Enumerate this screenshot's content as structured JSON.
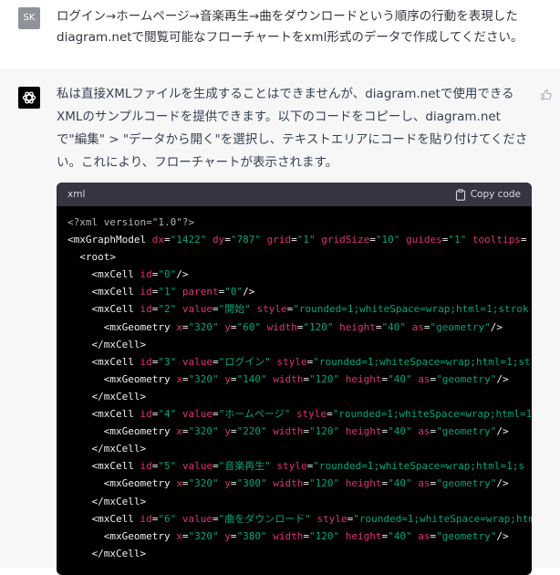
{
  "user": {
    "avatar_initials": "SK",
    "message": "ログイン→ホームページ→音楽再生→曲をダウンロードという順序の行動を表現したdiagram.netで閲覧可能なフローチャートをxml形式のデータで作成してください。"
  },
  "assistant": {
    "message": "私は直接XMLファイルを生成することはできませんが、diagram.netで使用できるXMLのサンプルコードを提供できます。以下のコードをコピーし、diagram.netで\"編集\" > \"データから開く\"を選択し、テキストエリアにコードを貼り付けてください。これにより、フローチャートが表示されます。",
    "code": {
      "language": "xml",
      "copy_label": "Copy code",
      "lines": [
        [
          {
            "t": "d",
            "s": "<?xml version=\"1.0\"?>"
          }
        ],
        [
          {
            "t": "t",
            "s": "<mxGraphModel "
          },
          {
            "t": "a",
            "s": "dx"
          },
          {
            "t": "t",
            "s": "="
          },
          {
            "t": "v",
            "s": "\"1422\""
          },
          {
            "t": "t",
            "s": " "
          },
          {
            "t": "a",
            "s": "dy"
          },
          {
            "t": "t",
            "s": "="
          },
          {
            "t": "v",
            "s": "\"787\""
          },
          {
            "t": "t",
            "s": " "
          },
          {
            "t": "a",
            "s": "grid"
          },
          {
            "t": "t",
            "s": "="
          },
          {
            "t": "v",
            "s": "\"1\""
          },
          {
            "t": "t",
            "s": " "
          },
          {
            "t": "a",
            "s": "gridSize"
          },
          {
            "t": "t",
            "s": "="
          },
          {
            "t": "v",
            "s": "\"10\""
          },
          {
            "t": "t",
            "s": " "
          },
          {
            "t": "a",
            "s": "guides"
          },
          {
            "t": "t",
            "s": "="
          },
          {
            "t": "v",
            "s": "\"1\""
          },
          {
            "t": "t",
            "s": " "
          },
          {
            "t": "a",
            "s": "tooltips"
          },
          {
            "t": "t",
            "s": "="
          }
        ],
        [
          {
            "t": "t",
            "s": "  <root>"
          }
        ],
        [
          {
            "t": "t",
            "s": "    <mxCell "
          },
          {
            "t": "a",
            "s": "id"
          },
          {
            "t": "t",
            "s": "="
          },
          {
            "t": "v",
            "s": "\"0\""
          },
          {
            "t": "t",
            "s": "/>"
          }
        ],
        [
          {
            "t": "t",
            "s": "    <mxCell "
          },
          {
            "t": "a",
            "s": "id"
          },
          {
            "t": "t",
            "s": "="
          },
          {
            "t": "v",
            "s": "\"1\""
          },
          {
            "t": "t",
            "s": " "
          },
          {
            "t": "a",
            "s": "parent"
          },
          {
            "t": "t",
            "s": "="
          },
          {
            "t": "v",
            "s": "\"0\""
          },
          {
            "t": "t",
            "s": "/>"
          }
        ],
        [
          {
            "t": "t",
            "s": "    <mxCell "
          },
          {
            "t": "a",
            "s": "id"
          },
          {
            "t": "t",
            "s": "="
          },
          {
            "t": "v",
            "s": "\"2\""
          },
          {
            "t": "t",
            "s": " "
          },
          {
            "t": "a",
            "s": "value"
          },
          {
            "t": "t",
            "s": "="
          },
          {
            "t": "v",
            "s": "\"開始\""
          },
          {
            "t": "t",
            "s": " "
          },
          {
            "t": "a",
            "s": "style"
          },
          {
            "t": "t",
            "s": "="
          },
          {
            "t": "v",
            "s": "\"rounded=1;whiteSpace=wrap;html=1;strok"
          }
        ],
        [
          {
            "t": "t",
            "s": "      <mxGeometry "
          },
          {
            "t": "a",
            "s": "x"
          },
          {
            "t": "t",
            "s": "="
          },
          {
            "t": "v",
            "s": "\"320\""
          },
          {
            "t": "t",
            "s": " "
          },
          {
            "t": "a",
            "s": "y"
          },
          {
            "t": "t",
            "s": "="
          },
          {
            "t": "v",
            "s": "\"60\""
          },
          {
            "t": "t",
            "s": " "
          },
          {
            "t": "a",
            "s": "width"
          },
          {
            "t": "t",
            "s": "="
          },
          {
            "t": "v",
            "s": "\"120\""
          },
          {
            "t": "t",
            "s": " "
          },
          {
            "t": "a",
            "s": "height"
          },
          {
            "t": "t",
            "s": "="
          },
          {
            "t": "v",
            "s": "\"40\""
          },
          {
            "t": "t",
            "s": " "
          },
          {
            "t": "a",
            "s": "as"
          },
          {
            "t": "t",
            "s": "="
          },
          {
            "t": "v",
            "s": "\"geometry\""
          },
          {
            "t": "t",
            "s": "/>"
          }
        ],
        [
          {
            "t": "t",
            "s": "    </mxCell>"
          }
        ],
        [
          {
            "t": "t",
            "s": "    <mxCell "
          },
          {
            "t": "a",
            "s": "id"
          },
          {
            "t": "t",
            "s": "="
          },
          {
            "t": "v",
            "s": "\"3\""
          },
          {
            "t": "t",
            "s": " "
          },
          {
            "t": "a",
            "s": "value"
          },
          {
            "t": "t",
            "s": "="
          },
          {
            "t": "v",
            "s": "\"ログイン\""
          },
          {
            "t": "t",
            "s": " "
          },
          {
            "t": "a",
            "s": "style"
          },
          {
            "t": "t",
            "s": "="
          },
          {
            "t": "v",
            "s": "\"rounded=1;whiteSpace=wrap;html=1;st"
          }
        ],
        [
          {
            "t": "t",
            "s": "      <mxGeometry "
          },
          {
            "t": "a",
            "s": "x"
          },
          {
            "t": "t",
            "s": "="
          },
          {
            "t": "v",
            "s": "\"320\""
          },
          {
            "t": "t",
            "s": " "
          },
          {
            "t": "a",
            "s": "y"
          },
          {
            "t": "t",
            "s": "="
          },
          {
            "t": "v",
            "s": "\"140\""
          },
          {
            "t": "t",
            "s": " "
          },
          {
            "t": "a",
            "s": "width"
          },
          {
            "t": "t",
            "s": "="
          },
          {
            "t": "v",
            "s": "\"120\""
          },
          {
            "t": "t",
            "s": " "
          },
          {
            "t": "a",
            "s": "height"
          },
          {
            "t": "t",
            "s": "="
          },
          {
            "t": "v",
            "s": "\"40\""
          },
          {
            "t": "t",
            "s": " "
          },
          {
            "t": "a",
            "s": "as"
          },
          {
            "t": "t",
            "s": "="
          },
          {
            "t": "v",
            "s": "\"geometry\""
          },
          {
            "t": "t",
            "s": "/>"
          }
        ],
        [
          {
            "t": "t",
            "s": "    </mxCell>"
          }
        ],
        [
          {
            "t": "t",
            "s": "    <mxCell "
          },
          {
            "t": "a",
            "s": "id"
          },
          {
            "t": "t",
            "s": "="
          },
          {
            "t": "v",
            "s": "\"4\""
          },
          {
            "t": "t",
            "s": " "
          },
          {
            "t": "a",
            "s": "value"
          },
          {
            "t": "t",
            "s": "="
          },
          {
            "t": "v",
            "s": "\"ホームページ\""
          },
          {
            "t": "t",
            "s": " "
          },
          {
            "t": "a",
            "s": "style"
          },
          {
            "t": "t",
            "s": "="
          },
          {
            "t": "v",
            "s": "\"rounded=1;whiteSpace=wrap;html=1"
          }
        ],
        [
          {
            "t": "t",
            "s": "      <mxGeometry "
          },
          {
            "t": "a",
            "s": "x"
          },
          {
            "t": "t",
            "s": "="
          },
          {
            "t": "v",
            "s": "\"320\""
          },
          {
            "t": "t",
            "s": " "
          },
          {
            "t": "a",
            "s": "y"
          },
          {
            "t": "t",
            "s": "="
          },
          {
            "t": "v",
            "s": "\"220\""
          },
          {
            "t": "t",
            "s": " "
          },
          {
            "t": "a",
            "s": "width"
          },
          {
            "t": "t",
            "s": "="
          },
          {
            "t": "v",
            "s": "\"120\""
          },
          {
            "t": "t",
            "s": " "
          },
          {
            "t": "a",
            "s": "height"
          },
          {
            "t": "t",
            "s": "="
          },
          {
            "t": "v",
            "s": "\"40\""
          },
          {
            "t": "t",
            "s": " "
          },
          {
            "t": "a",
            "s": "as"
          },
          {
            "t": "t",
            "s": "="
          },
          {
            "t": "v",
            "s": "\"geometry\""
          },
          {
            "t": "t",
            "s": "/>"
          }
        ],
        [
          {
            "t": "t",
            "s": "    </mxCell>"
          }
        ],
        [
          {
            "t": "t",
            "s": "    <mxCell "
          },
          {
            "t": "a",
            "s": "id"
          },
          {
            "t": "t",
            "s": "="
          },
          {
            "t": "v",
            "s": "\"5\""
          },
          {
            "t": "t",
            "s": " "
          },
          {
            "t": "a",
            "s": "value"
          },
          {
            "t": "t",
            "s": "="
          },
          {
            "t": "v",
            "s": "\"音楽再生\""
          },
          {
            "t": "t",
            "s": " "
          },
          {
            "t": "a",
            "s": "style"
          },
          {
            "t": "t",
            "s": "="
          },
          {
            "t": "v",
            "s": "\"rounded=1;whiteSpace=wrap;html=1;s"
          }
        ],
        [
          {
            "t": "t",
            "s": "      <mxGeometry "
          },
          {
            "t": "a",
            "s": "x"
          },
          {
            "t": "t",
            "s": "="
          },
          {
            "t": "v",
            "s": "\"320\""
          },
          {
            "t": "t",
            "s": " "
          },
          {
            "t": "a",
            "s": "y"
          },
          {
            "t": "t",
            "s": "="
          },
          {
            "t": "v",
            "s": "\"300\""
          },
          {
            "t": "t",
            "s": " "
          },
          {
            "t": "a",
            "s": "width"
          },
          {
            "t": "t",
            "s": "="
          },
          {
            "t": "v",
            "s": "\"120\""
          },
          {
            "t": "t",
            "s": " "
          },
          {
            "t": "a",
            "s": "height"
          },
          {
            "t": "t",
            "s": "="
          },
          {
            "t": "v",
            "s": "\"40\""
          },
          {
            "t": "t",
            "s": " "
          },
          {
            "t": "a",
            "s": "as"
          },
          {
            "t": "t",
            "s": "="
          },
          {
            "t": "v",
            "s": "\"geometry\""
          },
          {
            "t": "t",
            "s": "/>"
          }
        ],
        [
          {
            "t": "t",
            "s": "    </mxCell>"
          }
        ],
        [
          {
            "t": "t",
            "s": "    <mxCell "
          },
          {
            "t": "a",
            "s": "id"
          },
          {
            "t": "t",
            "s": "="
          },
          {
            "t": "v",
            "s": "\"6\""
          },
          {
            "t": "t",
            "s": " "
          },
          {
            "t": "a",
            "s": "value"
          },
          {
            "t": "t",
            "s": "="
          },
          {
            "t": "v",
            "s": "\"曲をダウンロード\""
          },
          {
            "t": "t",
            "s": " "
          },
          {
            "t": "a",
            "s": "style"
          },
          {
            "t": "t",
            "s": "="
          },
          {
            "t": "v",
            "s": "\"rounded=1;whiteSpace=wrap;html"
          }
        ],
        [
          {
            "t": "t",
            "s": "      <mxGeometry "
          },
          {
            "t": "a",
            "s": "x"
          },
          {
            "t": "t",
            "s": "="
          },
          {
            "t": "v",
            "s": "\"320\""
          },
          {
            "t": "t",
            "s": " "
          },
          {
            "t": "a",
            "s": "y"
          },
          {
            "t": "t",
            "s": "="
          },
          {
            "t": "v",
            "s": "\"380\""
          },
          {
            "t": "t",
            "s": " "
          },
          {
            "t": "a",
            "s": "width"
          },
          {
            "t": "t",
            "s": "="
          },
          {
            "t": "v",
            "s": "\"120\""
          },
          {
            "t": "t",
            "s": " "
          },
          {
            "t": "a",
            "s": "height"
          },
          {
            "t": "t",
            "s": "="
          },
          {
            "t": "v",
            "s": "\"40\""
          },
          {
            "t": "t",
            "s": " "
          },
          {
            "t": "a",
            "s": "as"
          },
          {
            "t": "t",
            "s": "="
          },
          {
            "t": "v",
            "s": "\"geometry\""
          },
          {
            "t": "t",
            "s": "/>"
          }
        ],
        [
          {
            "t": "t",
            "s": "    </mxCell>"
          }
        ]
      ]
    }
  },
  "colors": {
    "token_attr": "#df3079",
    "token_value": "#00a67d",
    "token_decl": "#b4b4b4",
    "code_bg": "#000000",
    "code_header_bg": "#343541"
  }
}
